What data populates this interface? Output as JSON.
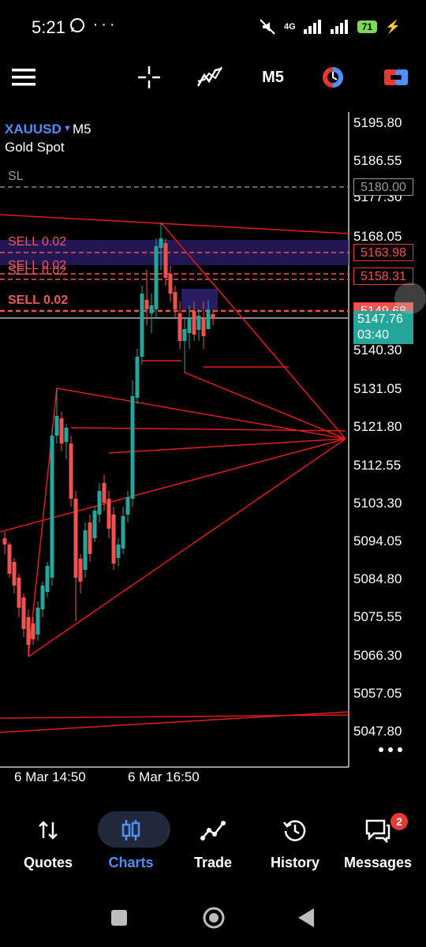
{
  "status_bar": {
    "time": "5:21",
    "network": "4G",
    "battery": "71"
  },
  "toolbar": {
    "timeframe": "M5"
  },
  "chart": {
    "symbol": "XAUUSD",
    "timeframe": "M5",
    "description": "Gold Spot",
    "sl_label": "SL",
    "price_axis": [
      "5195.80",
      "5186.55",
      "5177.30",
      "5168.05",
      "5140.30",
      "5131.05",
      "5121.80",
      "5112.55",
      "5103.30",
      "5094.05",
      "5084.80",
      "5075.55",
      "5066.30",
      "5057.05",
      "5047.80"
    ],
    "price_boxes": {
      "sl": "5180.00",
      "order1": "5163.98",
      "order2": "5158.31",
      "order3": "5149.68",
      "current": "5147.76",
      "timer": "03:40"
    },
    "orders": [
      "SELL 0.02",
      "SELL 0.02",
      "SELL 0.02",
      "SELL 0.02"
    ],
    "time_axis": [
      "6 Mar 14:50",
      "6 Mar 16:50"
    ],
    "colors": {
      "bull": "#26a69a",
      "bear": "#ef5350",
      "lines": "#e21b1b",
      "symbol": "#4f8ff7"
    }
  },
  "bottom_nav": {
    "items": [
      {
        "label": "Quotes",
        "icon": "quotes-icon"
      },
      {
        "label": "Charts",
        "icon": "charts-icon"
      },
      {
        "label": "Trade",
        "icon": "trade-icon"
      },
      {
        "label": "History",
        "icon": "history-icon"
      },
      {
        "label": "Messages",
        "icon": "messages-icon"
      }
    ],
    "active": "Charts",
    "messages_badge": "2"
  }
}
